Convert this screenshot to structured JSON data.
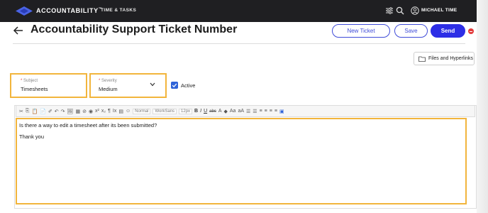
{
  "topbar": {
    "brand": "ACCOUNTABILITY",
    "trademark": "™",
    "section": "TIME & TASKS",
    "user_name": "MICHAEL TIME",
    "icons": [
      "settings-sliders-icon",
      "search-icon",
      "user-avatar-icon"
    ]
  },
  "header": {
    "title": "Accountability Support Ticket Number",
    "new_ticket_label": "New Ticket",
    "save_label": "Save",
    "send_label": "Send"
  },
  "files_button": {
    "label": "Files and Hyperlinks",
    "icon": "folder-icon"
  },
  "form": {
    "subject": {
      "label": "Subject",
      "required_mark": "*",
      "value": "Timesheets"
    },
    "severity": {
      "label": "Severity",
      "required_mark": "*",
      "value": "Medium"
    },
    "active": {
      "label": "Active",
      "checked": true
    }
  },
  "toolbar": {
    "items_a": [
      "✂",
      "⎘",
      "📋",
      "📄",
      "✐",
      "↶",
      "↷"
    ],
    "items_b": [
      "🖼",
      "▦",
      "⊘",
      "◉",
      "x²",
      "x₂",
      "¶",
      "Ix",
      "▤",
      "☺"
    ],
    "format_select": "Normal",
    "font_select": "WorkSans",
    "size_select": "12px",
    "bold": "B",
    "italic": "I",
    "underline": "U",
    "strike": "abc",
    "items_c": [
      "A",
      "◆",
      "Aa",
      "aA",
      "☰",
      "☰",
      "≡",
      "≡",
      "≡",
      "≡",
      "▣"
    ]
  },
  "editor": {
    "line1": "Is there a way to edit a timesheet after its been submitted?",
    "line2": "Thank you"
  },
  "colors": {
    "topbar_bg": "#1f1f22",
    "accent": "#2d2ee6",
    "highlight": "#f2b53c",
    "checkbox": "#2f63d8"
  }
}
